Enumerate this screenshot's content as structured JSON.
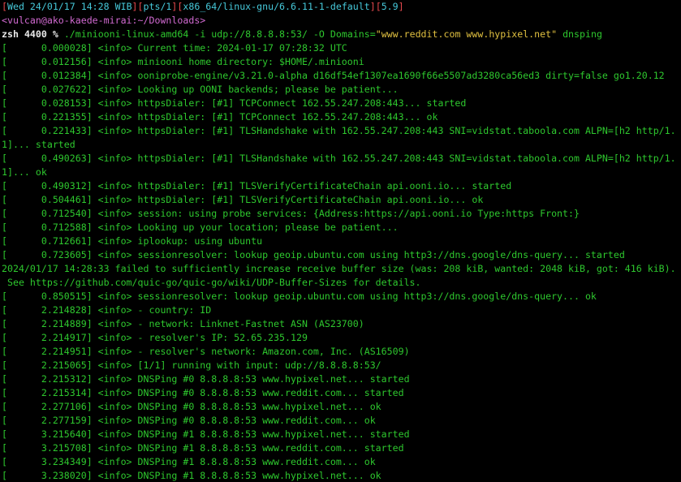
{
  "status_bar": {
    "datetime": "Wed 24/01/17 14:28 WIB",
    "pts": "pts/1",
    "kernel": "x86_64/linux-gnu/6.6.11-1-default",
    "load": "5.9"
  },
  "prompt": {
    "user_host_path": "<vulcan@ako-kaede-mirai:~/Downloads>",
    "shell": "zsh",
    "history_num": "4400",
    "symbol": "%",
    "command_pre": "./miniooni-linux-amd64 -i udp://8.8.8.8:53/ -O Domains=",
    "command_str": "\"www.reddit.com www.hypixel.net\"",
    "command_post": " dnsping"
  },
  "output_lines": [
    "[      0.000028] <info> Current time: 2024-01-17 07:28:32 UTC",
    "[      0.012156] <info> miniooni home directory: $HOME/.miniooni",
    "[      0.012384] <info> ooniprobe-engine/v3.21.0-alpha d16df54ef1307ea1690f66e5507ad3280ca56ed3 dirty=false go1.20.12",
    "[      0.027622] <info> Looking up OONI backends; please be patient...",
    "[      0.028153] <info> httpsDialer: [#1] TCPConnect 162.55.247.208:443... started",
    "[      0.221355] <info> httpsDialer: [#1] TCPConnect 162.55.247.208:443... ok",
    "[      0.221433] <info> httpsDialer: [#1] TLSHandshake with 162.55.247.208:443 SNI=vidstat.taboola.com ALPN=[h2 http/1.",
    "1]... started",
    "[      0.490263] <info> httpsDialer: [#1] TLSHandshake with 162.55.247.208:443 SNI=vidstat.taboola.com ALPN=[h2 http/1.",
    "1]... ok",
    "[      0.490312] <info> httpsDialer: [#1] TLSVerifyCertificateChain api.ooni.io... started",
    "[      0.504461] <info> httpsDialer: [#1] TLSVerifyCertificateChain api.ooni.io... ok",
    "[      0.712540] <info> session: using probe services: {Address:https://api.ooni.io Type:https Front:}",
    "[      0.712588] <info> Looking up your location; please be patient...",
    "[      0.712661] <info> iplookup: using ubuntu",
    "[      0.723605] <info> sessionresolver: lookup geoip.ubuntu.com using http3://dns.google/dns-query... started",
    "2024/01/17 14:28:33 failed to sufficiently increase receive buffer size (was: 208 kiB, wanted: 2048 kiB, got: 416 kiB).",
    " See https://github.com/quic-go/quic-go/wiki/UDP-Buffer-Sizes for details.",
    "[      0.850515] <info> sessionresolver: lookup geoip.ubuntu.com using http3://dns.google/dns-query... ok",
    "[      2.214828] <info> - country: ID",
    "[      2.214889] <info> - network: Linknet-Fastnet ASN (AS23700)",
    "[      2.214917] <info> - resolver's IP: 52.65.235.129",
    "[      2.214951] <info> - resolver's network: Amazon.com, Inc. (AS16509)",
    "[      2.215065] <info> [1/1] running with input: udp://8.8.8.8:53/",
    "[      2.215312] <info> DNSPing #0 8.8.8.8:53 www.hypixel.net... started",
    "[      2.215314] <info> DNSPing #0 8.8.8.8:53 www.reddit.com... started",
    "[      2.277106] <info> DNSPing #0 8.8.8.8:53 www.hypixel.net... ok",
    "[      2.277159] <info> DNSPing #0 8.8.8.8:53 www.reddit.com... ok",
    "[      3.215640] <info> DNSPing #1 8.8.8.8:53 www.hypixel.net... started",
    "[      3.215708] <info> DNSPing #1 8.8.8.8:53 www.reddit.com... started",
    "[      3.234349] <info> DNSPing #1 8.8.8.8:53 www.reddit.com... ok",
    "[      3.238020] <info> DNSPing #1 8.8.8.8:53 www.hypixel.net... ok"
  ],
  "colors": {
    "background": "#000000",
    "output_green": "#2ec82e",
    "bracket_red": "#e5484d",
    "status_cyan": "#46c8d9",
    "prompt_magenta": "#d26ad2",
    "string_yellow": "#e0c040"
  }
}
